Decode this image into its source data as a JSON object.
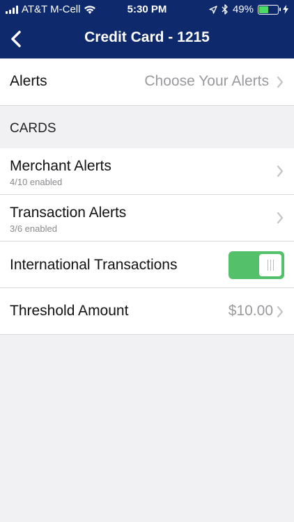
{
  "status_bar": {
    "carrier": "AT&T M-Cell",
    "time": "5:30 PM",
    "battery_percent": "49%",
    "battery_level": 0.49
  },
  "nav": {
    "title": "Credit Card - 1215",
    "back_icon": "chevron-left-icon"
  },
  "alerts_row": {
    "label": "Alerts",
    "value": "Choose Your Alerts"
  },
  "cards_section": {
    "header": "CARDS",
    "rows": [
      {
        "label": "Merchant Alerts",
        "sub": "4/10 enabled"
      },
      {
        "label": "Transaction Alerts",
        "sub": "3/6 enabled"
      }
    ],
    "international": {
      "label": "International Transactions",
      "enabled": true
    },
    "threshold": {
      "label": "Threshold Amount",
      "value": "$10.00"
    }
  },
  "colors": {
    "header_bg": "#0e2a6c",
    "toggle_on": "#55c06a",
    "page_bg": "#f1f1f3"
  }
}
